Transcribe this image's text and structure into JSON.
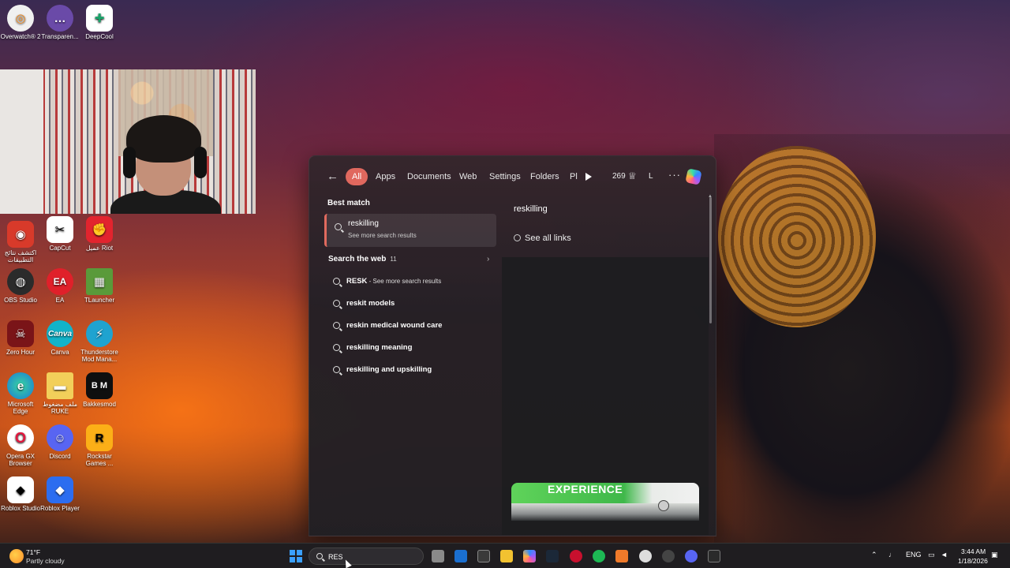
{
  "desktop": {
    "icons": [
      {
        "label": "Overwatch® 2"
      },
      {
        "label": "Transparen..."
      },
      {
        "label": "DeepCool"
      },
      {
        "label": "اكتشف نتائج التطبيقات"
      },
      {
        "label": "CapCut"
      },
      {
        "label": "عميل Riot"
      },
      {
        "label": "OBS Studio"
      },
      {
        "label": "EA"
      },
      {
        "label": "TLauncher"
      },
      {
        "label": "Zero Hour"
      },
      {
        "label": "Canva"
      },
      {
        "label": "Thunderstore Mod Mana..."
      },
      {
        "label": "Microsoft Edge"
      },
      {
        "label": "ملف مضغوط RUKE"
      },
      {
        "label": "Bakkesmod"
      },
      {
        "label": "Opera GX Browser"
      },
      {
        "label": "Discord"
      },
      {
        "label": "Rockstar Games ..."
      },
      {
        "label": "Roblox Studio"
      },
      {
        "label": "Roblox Player"
      }
    ]
  },
  "search_menu": {
    "filters": [
      "All",
      "Apps",
      "Documents",
      "Web",
      "Settings",
      "Folders",
      "Pl"
    ],
    "points": "269",
    "profile_initial": "L",
    "more": "···",
    "best_match_title": "Best match",
    "best_match": {
      "title": "reskilling",
      "subtitle": "See more search results"
    },
    "web_section": {
      "title": "Search the web",
      "count": "11"
    },
    "web_results": [
      {
        "bold": "RESK",
        "rest": " - See more search results"
      },
      {
        "bold": "reskit models",
        "rest": ""
      },
      {
        "bold": "reskin medical wound care",
        "rest": ""
      },
      {
        "bold": "reskilling meaning",
        "rest": ""
      },
      {
        "bold": "reskilling and upskilling",
        "rest": ""
      }
    ],
    "preview": {
      "title": "reskilling",
      "see_all": "See all links",
      "ad_word": "EXPERIENCE"
    }
  },
  "taskbar": {
    "weather": {
      "temp": "71°F",
      "condition": "Partly cloudy"
    },
    "search_value": "RES",
    "language": "ENG",
    "time": "3:44 AM",
    "date": "1/18/2026"
  }
}
